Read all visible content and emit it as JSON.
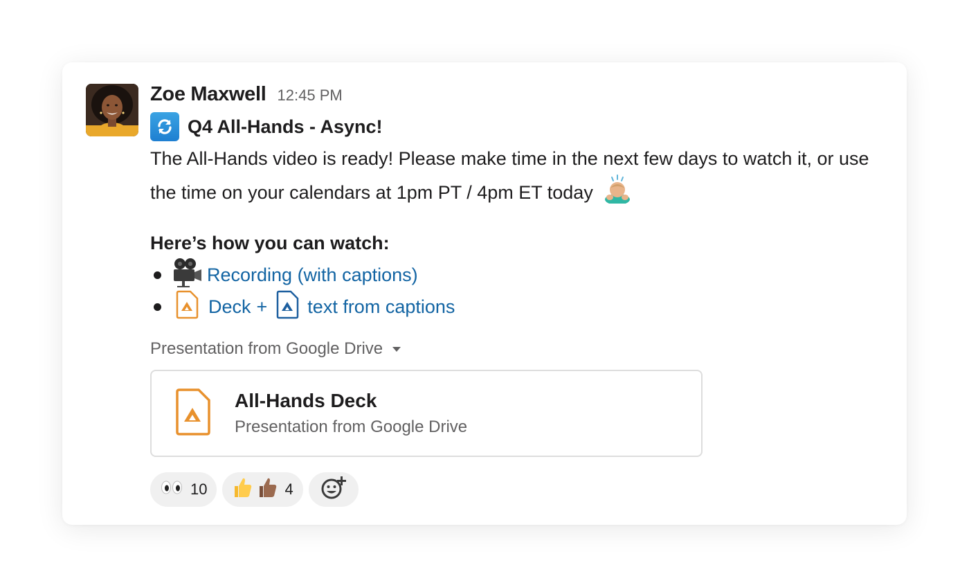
{
  "message": {
    "author": "Zoe Maxwell",
    "timestamp": "12:45 PM",
    "title": "Q4 All-Hands - Async!",
    "body": "The All-Hands video is ready! Please make time in the next few days to watch it, or use the time on your calendars at 1pm PT / 4pm ET today",
    "subhead": "Here’s how you can watch:",
    "bullets": {
      "recording_link": "Recording (with captions)",
      "deck_link": "Deck",
      "plus": "+",
      "captions_link": "text from captions"
    }
  },
  "attachment": {
    "label": "Presentation from Google Drive",
    "title": "All-Hands Deck",
    "subtitle": "Presentation from Google Drive"
  },
  "reactions": [
    {
      "emoji": "eyes-icon",
      "count": "10"
    },
    {
      "emoji": "thumbs-up-icon",
      "count": "4"
    }
  ],
  "colors": {
    "link": "#1264a3",
    "orange": "#e8912d",
    "blue_file": "#1d5f9f"
  }
}
